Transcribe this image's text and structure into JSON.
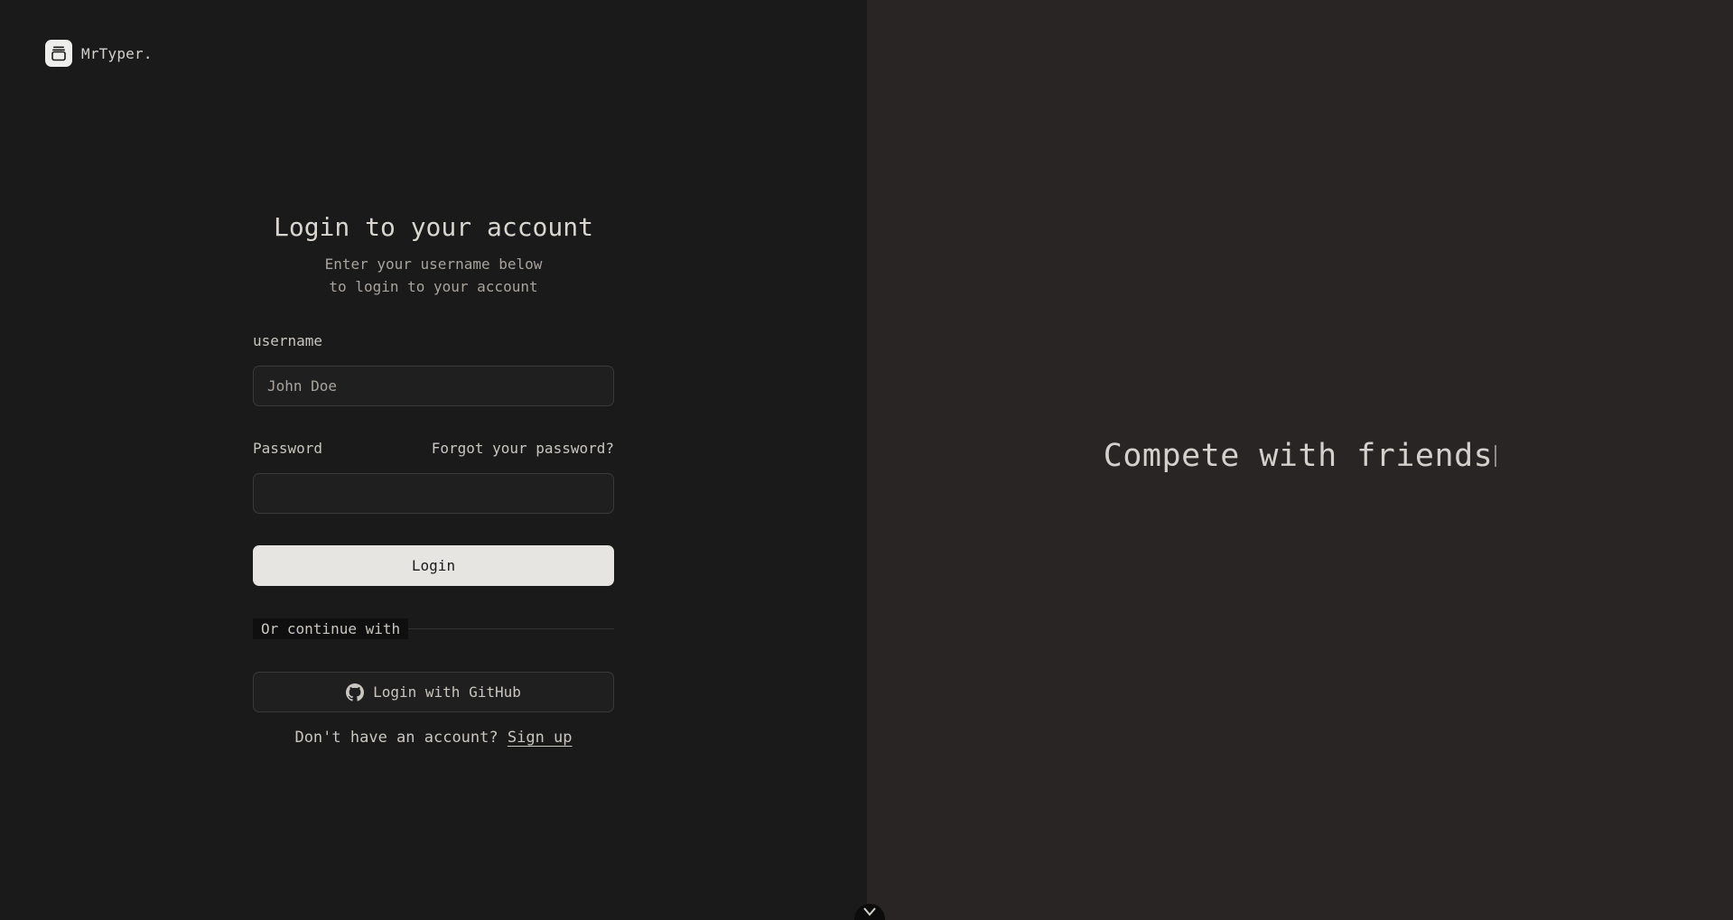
{
  "brand": {
    "name": "MrTyper.",
    "icon": "stack-icon"
  },
  "login": {
    "title": "Login to your account",
    "subtitle_line1": "Enter your username below",
    "subtitle_line2": "to login to your account",
    "username_label": "username",
    "username_placeholder": "John Doe",
    "username_value": "",
    "password_label": "Password",
    "password_value": "",
    "forgot_link": "Forgot your password?",
    "submit_label": "Login",
    "divider_text": "Or continue with",
    "github_label": "Login with GitHub",
    "github_icon": "github-icon",
    "signup_prompt": "Don't have an account?",
    "signup_link": "Sign up"
  },
  "hero": {
    "tagline": "Compete with friends"
  },
  "colors": {
    "left_bg": "#1a1a1b",
    "right_bg": "#292524",
    "button_bg": "#e7e5e2"
  }
}
